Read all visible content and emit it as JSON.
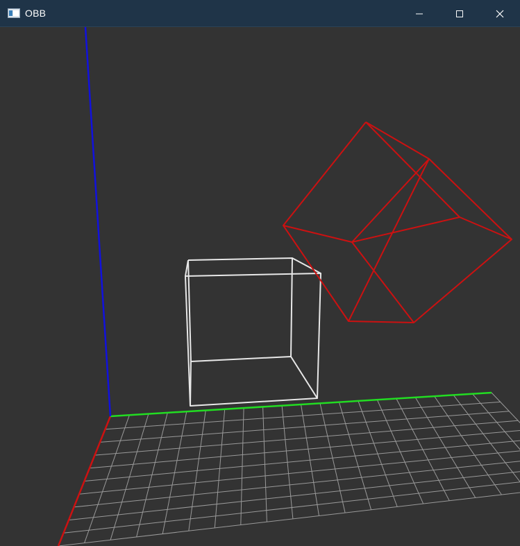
{
  "window": {
    "title": "OBB",
    "controls": {
      "minimize": "minimize-icon",
      "maximize": "maximize-icon",
      "close": "close-icon"
    }
  },
  "colors": {
    "titlebar": "#1f3448",
    "background": "#333333",
    "grid": "#9a9a9a",
    "axis_x": "#cc1111",
    "axis_y": "#22dd22",
    "axis_z": "#1111dd",
    "box_aligned": "#e8e8e8",
    "box_oriented": "#cc1111"
  }
}
